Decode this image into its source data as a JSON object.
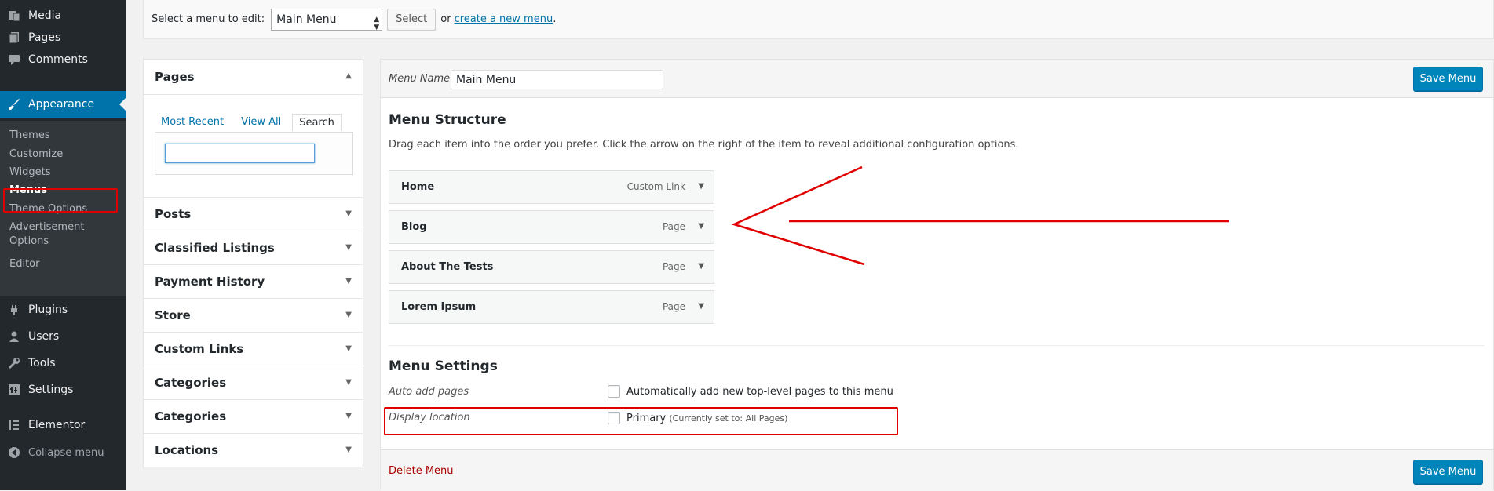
{
  "sidebar": {
    "items": [
      {
        "label": "Media",
        "icon": "media-icon"
      },
      {
        "label": "Pages",
        "icon": "pages-icon"
      },
      {
        "label": "Comments",
        "icon": "comments-icon"
      },
      {
        "label": "Appearance",
        "icon": "paintbrush-icon"
      }
    ],
    "submenu": [
      "Themes",
      "Customize",
      "Widgets",
      "Menus",
      "Theme Options",
      "Advertisement Options",
      "Editor"
    ],
    "lower_items": [
      {
        "label": "Plugins",
        "icon": "plugin-icon"
      },
      {
        "label": "Users",
        "icon": "users-icon"
      },
      {
        "label": "Tools",
        "icon": "wrench-icon"
      },
      {
        "label": "Settings",
        "icon": "settings-icon"
      },
      {
        "label": "Elementor",
        "icon": "elementor-icon"
      }
    ],
    "collapse_label": "Collapse menu",
    "accent_color": "#0073aa"
  },
  "topbar": {
    "select_label": "Select a menu to edit:",
    "selected_menu": "Main Menu",
    "select_button": "Select",
    "or_text": "or",
    "create_link": "create a new menu",
    "period": "."
  },
  "metaboxes": {
    "pages": {
      "title": "Pages",
      "tabs": [
        "Most Recent",
        "View All",
        "Search"
      ],
      "active_tab": "Search"
    },
    "sections": [
      "Posts",
      "Classified Listings",
      "Payment History",
      "Store",
      "Custom Links",
      "Categories",
      "Categories",
      "Locations"
    ]
  },
  "editor": {
    "menu_name_label": "Menu Name",
    "menu_name_value": "Main Menu",
    "save_button": "Save Menu",
    "structure_title": "Menu Structure",
    "structure_desc": "Drag each item into the order you prefer. Click the arrow on the right of the item to reveal additional configuration options.",
    "items": [
      {
        "title": "Home",
        "type": "Custom Link"
      },
      {
        "title": "Blog",
        "type": "Page"
      },
      {
        "title": "About The Tests",
        "type": "Page"
      },
      {
        "title": "Lorem Ipsum",
        "type": "Page"
      }
    ],
    "settings_title": "Menu Settings",
    "auto_add_label": "Auto add pages",
    "auto_add_text": "Automatically add new top-level pages to this menu",
    "display_location_label": "Display location",
    "primary_text": "Primary",
    "primary_note": "(Currently set to: All Pages)",
    "delete_link": "Delete Menu",
    "primary_color": "#0085ba",
    "annotation_color": "#e00000"
  }
}
